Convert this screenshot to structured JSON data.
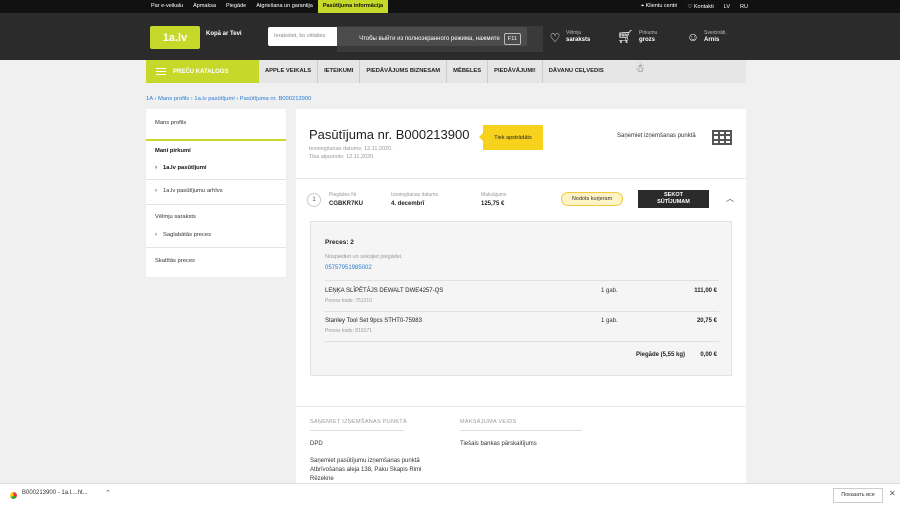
{
  "topbar": {
    "nav": [
      "Par e-veikalu",
      "Apmaksa",
      "Piegāde",
      "Atgriešana un garantija",
      "Pasūtījuma informācija"
    ],
    "active_index": 4,
    "client_center": "Klientu centri",
    "contacts": "Kontakti",
    "lang_lv": "LV",
    "lang_ru": "RU"
  },
  "header": {
    "logo": "1a.lv",
    "tagline": "Kopā ar Tevi",
    "search_placeholder": "Ierakstiet, ko vēlaties",
    "fullscreen_notice": "Чтобы выйти из полноэкранного режима, нажмите",
    "fullscreen_key": "F11",
    "wishlist_top": "Vēlmju",
    "wishlist_bottom": "saraksts",
    "cart_top": "Pirkumu",
    "cart_bottom": "grozs",
    "user_top": "Sveicināti,",
    "user_name": "Arnis"
  },
  "catalog": {
    "button": "PREČU KATALOGS",
    "items": [
      "APPLE VEIKALS",
      "IETEIKUMI",
      "PIEDĀVĀJUMS BIZNESAM",
      "MĒBELES",
      "PIEDĀVĀJUMI!",
      "DĀVANU CEĻVEDIS"
    ]
  },
  "breadcrumb": {
    "items": [
      "1A",
      "Mans profils",
      "1a.lv pasūtījumi",
      "Pasūtījuma nr. B000213900"
    ]
  },
  "sidebar": {
    "profile": "Mans profils",
    "purchases": "Mani pirkumi",
    "orders": "1a.lv pasūtījumi",
    "archive": "1a.lv pasūtījumu arhīvs",
    "wishlist": "Vēlmju saraksts",
    "saved": "Saglabātās preces",
    "viewed": "Skatītās preces"
  },
  "order": {
    "title": "Pasūtījuma nr. B000213900",
    "status": "Tiek apstrādāts",
    "submitted": "Iesniegšanas datums: 12.11.2020.",
    "created": "Tika atjaunots: 12.11.2020.",
    "pickup": "Saņemiet izņemšanas punktā",
    "shipment_num": "1",
    "col1_label": "Piegādes Nr",
    "col1_value": "CGBKR7KU",
    "col2_label": "Izsniegšanas datums",
    "col2_value": "4. decembrī",
    "col3_label": "Maksājums",
    "col3_value": "125,75 €",
    "courier_badge": "Nodots kurjeram",
    "track_button_line1": "SEKOT",
    "track_button_line2": "SŪTĪJUMAM",
    "goods_title": "Preces: 2",
    "goods_hint": "Nospiediet un sekojiet piegādei.",
    "tracking_number": "05757951985002",
    "items": [
      {
        "name": "LEŅĶA SLĪPĒTĀJS DEWALT DWE4257-QS",
        "code": "Preces kods: 751210",
        "qty": "1 gab.",
        "price": "111,00 €"
      },
      {
        "name": "Stanley Tool Set 9pcs STHT0-75983",
        "code": "Preces kods: 819171",
        "qty": "1 gab.",
        "price": "20,75 €"
      }
    ],
    "shipping_label": "Piegāde (5,55 kg)",
    "shipping_value": "0,00 €",
    "pickup_section": "SAŅEMIET IZŅEMŠANAS PUNKTĀ",
    "payment_section": "MAKSĀJUMA VEIDS",
    "pickup_provider": "DPD",
    "pickup_line1": "Saņemiet pasūtījumu izņemšanas punktā",
    "pickup_line2": "Atbrīvošanas aleja 138, Paku Skapis Rimi",
    "pickup_line3": "Rēzekne",
    "payment_method": "Tiešais bankas pārskaitījums"
  },
  "downloads": {
    "file": "B000213900 - 1a.l....ht...",
    "show_all": "Показать все"
  }
}
